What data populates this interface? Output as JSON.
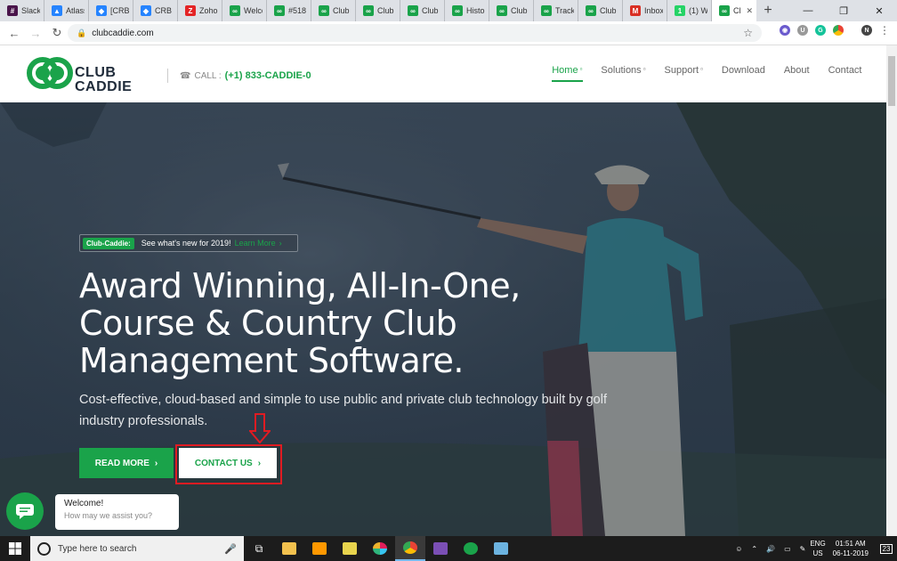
{
  "browser": {
    "tabs": [
      {
        "label": "Slack",
        "icon": "slack-icon",
        "color": "#4a154b",
        "glyph": "#"
      },
      {
        "label": "Atlass",
        "icon": "atlassian-icon",
        "color": "#2684ff",
        "glyph": "▲"
      },
      {
        "label": "[CRB-",
        "icon": "jira-icon",
        "color": "#2684ff",
        "glyph": "◆"
      },
      {
        "label": "CRB t",
        "icon": "jira-icon",
        "color": "#2684ff",
        "glyph": "◆"
      },
      {
        "label": "Zoho",
        "icon": "zoho-icon",
        "color": "#e42527",
        "glyph": "Z"
      },
      {
        "label": "Welco",
        "icon": "clubcaddie-icon",
        "color": "#1aa34a",
        "glyph": "∞"
      },
      {
        "label": "#518",
        "icon": "clubcaddie-icon",
        "color": "#1aa34a",
        "glyph": "∞"
      },
      {
        "label": "Club",
        "icon": "clubcaddie-icon",
        "color": "#1aa34a",
        "glyph": "∞"
      },
      {
        "label": "Club",
        "icon": "clubcaddie-icon",
        "color": "#1aa34a",
        "glyph": "∞"
      },
      {
        "label": "Club",
        "icon": "clubcaddie-icon",
        "color": "#1aa34a",
        "glyph": "∞"
      },
      {
        "label": "Histor",
        "icon": "clubcaddie-icon",
        "color": "#1aa34a",
        "glyph": "∞"
      },
      {
        "label": "Club",
        "icon": "clubcaddie-icon",
        "color": "#1aa34a",
        "glyph": "∞"
      },
      {
        "label": "Track",
        "icon": "clubcaddie-icon",
        "color": "#1aa34a",
        "glyph": "∞"
      },
      {
        "label": "Club",
        "icon": "clubcaddie-icon",
        "color": "#1aa34a",
        "glyph": "∞"
      },
      {
        "label": "Inbox",
        "icon": "gmail-icon",
        "color": "#d93025",
        "glyph": "M"
      },
      {
        "label": "(1) W",
        "icon": "whatsapp-icon",
        "color": "#25d366",
        "glyph": "1"
      },
      {
        "label": "Cl",
        "icon": "clubcaddie-icon",
        "color": "#1aa34a",
        "glyph": "∞",
        "active": true
      }
    ],
    "url": "clubcaddie.com",
    "profile_initial": "N"
  },
  "site": {
    "logo_line1": "CLUB",
    "logo_line2": "CADDIE",
    "call_label": "CALL :",
    "call_number": "(+1) 833-CADDIE-0",
    "nav": [
      {
        "label": "Home",
        "dropdown": true,
        "active": true
      },
      {
        "label": "Solutions",
        "dropdown": true
      },
      {
        "label": "Support",
        "dropdown": true
      },
      {
        "label": "Download",
        "dropdown": false
      },
      {
        "label": "About",
        "dropdown": false
      },
      {
        "label": "Contact",
        "dropdown": false
      }
    ],
    "colors": {
      "brand_green": "#1aa34a",
      "highlight_red": "#e01b22"
    }
  },
  "hero": {
    "badge_tag": "Club-Caddie:",
    "badge_text": "See what's new for 2019!",
    "badge_link": "Learn More",
    "headline_line1": "Award Winning, All-In-One,",
    "headline_line2": "Course & Country Club",
    "headline_line3": "Management Software.",
    "subline": "Cost-effective, cloud-based and simple to use public and private club technology built by golf industry professionals.",
    "read_more": "READ MORE",
    "contact_us": "CONTACT US"
  },
  "chat": {
    "title": "Welcome!",
    "subtitle": "How may we assist you?"
  },
  "taskbar": {
    "search_placeholder": "Type here to search",
    "lang1": "ENG",
    "lang2": "US",
    "time": "01:51 AM",
    "date": "06-11-2019",
    "notifications": "23"
  }
}
